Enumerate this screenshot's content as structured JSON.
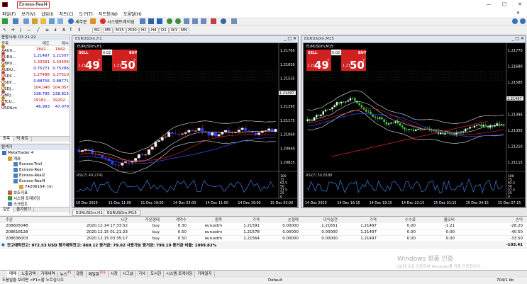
{
  "window": {
    "title": "Exness-Real4"
  },
  "menu": [
    "파일(F)",
    "보기(V)",
    "삽입(I)",
    "차트(C)",
    "도구(T)",
    "차트창(W)",
    "도움말(H)"
  ],
  "toolbar": {
    "new_order": "새주문",
    "auto_trading": "시스템트레이딩",
    "timeframes": [
      "M1",
      "M5",
      "M15",
      "M30",
      "H1",
      "H4",
      "D1",
      "W1",
      "MN"
    ]
  },
  "market_watch": {
    "header": "종합시세: 07:21:22",
    "cols": [
      "종목",
      "매도",
      "매수"
    ],
    "rows": [
      {
        "symbol": "XAUU...",
        "bid": "1842...",
        "ask": "1842...",
        "color": "#d08000"
      },
      {
        "symbol": "EURU...",
        "bid": "1.21497",
        "ask": "1.21507",
        "color": "#d04020"
      },
      {
        "symbol": "GBPU...",
        "bid": "1.33391",
        "ask": "1.33406",
        "color": "#d04020"
      },
      {
        "symbol": "AUDU...",
        "bid": "0.75271",
        "ask": "0.75286",
        "color": "#d08000"
      },
      {
        "symbol": "USDC...",
        "bid": "1.27488",
        "ask": "1.27510",
        "color": "#d04020"
      },
      {
        "symbol": "USDC...",
        "bid": "0.88756",
        "ask": "0.88771",
        "color": "#d04020"
      },
      {
        "symbol": "USDJ...",
        "bid": "104.046",
        "ask": "104.057",
        "color": "#d08000"
      },
      {
        "symbol": "GBPJ...",
        "bid": "138.795",
        "ask": "138.815",
        "color": "#d04020"
      },
      {
        "symbol": "BTCU...",
        "bid": "19182...",
        "ask": "19202...",
        "color": "#d08000"
      },
      {
        "symbol": "USOILm",
        "bid": "46.993",
        "ask": "47.079",
        "color": "#d04020"
      }
    ],
    "tabs": [
      "종목",
      "틱 차트"
    ]
  },
  "navigator": {
    "header": "탐색기",
    "items": [
      {
        "label": "MetaTrader 4",
        "indent": 0
      },
      {
        "label": "계좌",
        "indent": 1
      },
      {
        "label": "Exness-Trial",
        "indent": 2
      },
      {
        "label": "Exness-Real",
        "indent": 2
      },
      {
        "label": "Exness-Real2",
        "indent": 2
      },
      {
        "label": "Exness-Real4",
        "indent": 2
      },
      {
        "label": "74206154: tm",
        "indent": 3
      },
      {
        "label": "보조지표",
        "indent": 1
      },
      {
        "label": "시스템 트레이딩",
        "indent": 1
      },
      {
        "label": "스크립트",
        "indent": 1
      }
    ],
    "tabs": [
      "일반",
      "즐겨찾기"
    ]
  },
  "chart1": {
    "title": "EURUSDm,H1",
    "inner_title": "EURUSDm,H1",
    "lot": "0.02",
    "sell": "SELL",
    "buy": "BUY",
    "sell_price_small": "1.21",
    "sell_price_big": "49",
    "sell_price_sup": "7",
    "buy_price_small": "1.21",
    "buy_price_big": "50",
    "buy_price_sup": "7",
    "yticks": [
      "1.21765",
      "1.21650",
      "1.21535",
      "1.21415",
      "1.21295",
      "1.21175",
      "1.21060",
      "1.20940",
      "1.20825"
    ],
    "current_price": "1.21497",
    "rsi_label": "RSI(7) 49.2741",
    "rsi_ticks": [
      "100",
      "75",
      "62.5",
      "50",
      "37.5",
      "25",
      "0"
    ],
    "xticks": [
      "10 Dec 2020",
      "11 Dec 11:00",
      "11 Dec 19:00",
      "14 Dec 03:00",
      "14 Dec 11:00",
      "14 Dec 19:00",
      "15 Dec 03:00"
    ]
  },
  "chart2": {
    "title": "EURUSDm,M15",
    "inner_title": "EURUSDm,M15",
    "lot": "0.02",
    "sell": "SELL",
    "buy": "BUY",
    "sell_price_small": "1.21",
    "sell_price_big": "49",
    "sell_price_sup": "7",
    "buy_price_small": "1.21",
    "buy_price_big": "50",
    "buy_price_sup": "7",
    "yticks": [
      "1.21770",
      "1.21680",
      "1.21585",
      "1.21490",
      "1.21395",
      "1.21305",
      "1.21210",
      "1.21115"
    ],
    "current_price": "1.21497",
    "rsi_label": "RSI(7) 50.8188",
    "rsi_ticks": [
      "100",
      "75",
      "62.5",
      "50",
      "37.5",
      "25",
      "0"
    ],
    "xticks": [
      "14 Dec 2020",
      "14 Dec 16:15",
      "14 Dec 19:15",
      "14 Dec 22:15",
      "15 Dec 01:15",
      "15 Dec 04:15",
      "15 Dec 07:15"
    ]
  },
  "chart_tabs": [
    "EURUSDm,H1",
    "EURUSDm,M15"
  ],
  "terminal": {
    "cols": [
      "주문",
      "시간",
      "주문형태",
      "계약수",
      "종목",
      "가격",
      "손절매",
      "이익실현",
      "가격",
      "수수료",
      "롤오버",
      "손익"
    ],
    "rows": [
      [
        "208605048",
        "2020.12.14 17:33:52",
        "buy",
        "0.30",
        "eurusdm",
        "1.21591",
        "0.00000",
        "1.21651",
        "1.21497",
        "0.00",
        "-1.21",
        "-28.20"
      ],
      [
        "208618128",
        "2020.12.15 01:21:23",
        "buy",
        "0.50",
        "eurusdm",
        "1.21578",
        "0.00000",
        "0.00000",
        "1.21497",
        "0.00",
        "0.00",
        "-40.50"
      ],
      [
        "208636003",
        "2020.12.15 03:35:17",
        "buy",
        "0.50",
        "eurusdm",
        "1.21564",
        "0.00000",
        "0.00000",
        "1.21497",
        "0.00",
        "0.00",
        "-33.50"
      ]
    ],
    "summary": "잔고예탁잔고: 972.53 USD  평가예탁잔고: 869.12  증거금: 79.02  사용가능 증거금: 790.10  증거금 비율: 1099.82%",
    "summary_total": "-103.41",
    "tabs": [
      "매매",
      "노출금액",
      "거래내역",
      "뉴스",
      "알림",
      "메일함",
      "시장",
      "시그널",
      "기사",
      "도서관",
      "시스템 트레이딩",
      "거래일지"
    ],
    "news_count": "45",
    "mail_count": "103"
  },
  "watermark": {
    "line1": "Windows 정품 인증",
    "line2": "[설정]으로 이동하여 Windows를 정품 인증합니다."
  },
  "status": {
    "help": "도움말을 보려면 <F1>을 누르십시오",
    "profile": "Default",
    "traffic": "704/1 kb"
  }
}
